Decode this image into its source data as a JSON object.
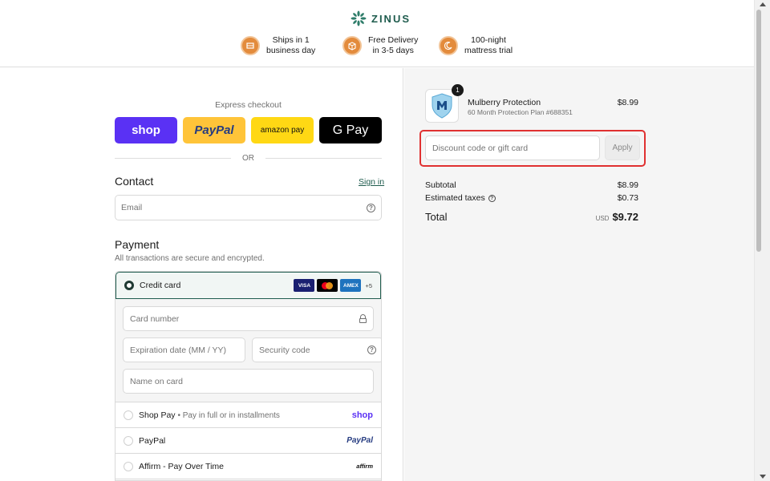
{
  "brand": {
    "name": "ZINUS",
    "accent": "#1f5c4e"
  },
  "perks": [
    {
      "icon": "shipping-box-icon",
      "line1": "Ships in 1",
      "line2": "business day"
    },
    {
      "icon": "delivery-box-icon",
      "line1": "Free Delivery",
      "line2": "in 3-5 days"
    },
    {
      "icon": "moon-trial-icon",
      "line1": "100-night",
      "line2": "mattress trial"
    }
  ],
  "express": {
    "label": "Express checkout",
    "shop": "shop",
    "paypal": "PayPal",
    "amazon": "amazon pay",
    "gpay": "G Pay",
    "or": "OR"
  },
  "contact": {
    "title": "Contact",
    "signin": "Sign in",
    "email_placeholder": "Email"
  },
  "payment": {
    "title": "Payment",
    "subtitle": "All transactions are secure and encrypted.",
    "credit_card_label": "Credit card",
    "brands": [
      "VISA",
      "MC",
      "AMEX"
    ],
    "more_brands": "+5",
    "card_number_placeholder": "Card number",
    "expiry_placeholder": "Expiration date (MM / YY)",
    "security_placeholder": "Security code",
    "name_placeholder": "Name on card",
    "shop_pay_label": "Shop Pay",
    "shop_pay_sub": "• Pay in full or in installments",
    "shop_pay_logo": "shop",
    "paypal_label": "PayPal",
    "paypal_logo": "PayPal",
    "affirm_label": "Affirm - Pay Over Time",
    "affirm_logo": "affirm"
  },
  "order": {
    "item": {
      "name": "Mulberry Protection",
      "subtitle": "60 Month Protection Plan #688351",
      "price": "$8.99",
      "quantity": "1"
    },
    "discount_placeholder": "Discount code or gift card",
    "apply_label": "Apply",
    "subtotal_label": "Subtotal",
    "subtotal_value": "$8.99",
    "taxes_label": "Estimated taxes",
    "taxes_value": "$0.73",
    "total_label": "Total",
    "currency": "USD",
    "total_value": "$9.72"
  }
}
